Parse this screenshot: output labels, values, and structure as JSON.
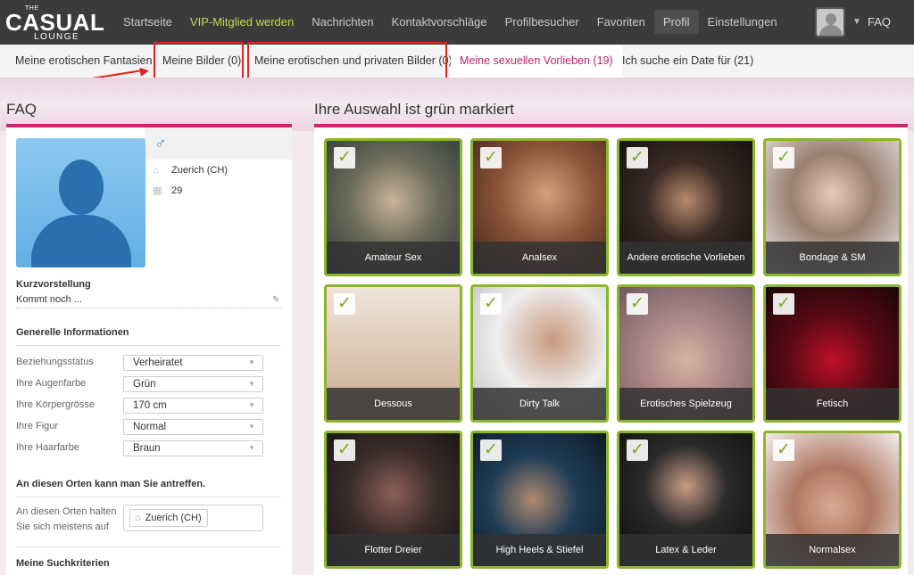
{
  "logo": {
    "the": "THE",
    "casual": "CASUAL",
    "lounge": "LOUNGE"
  },
  "nav": {
    "items": [
      {
        "label": "Startseite"
      },
      {
        "label": "VIP-Mitglied werden"
      },
      {
        "label": "Nachrichten"
      },
      {
        "label": "Kontaktvorschläge"
      },
      {
        "label": "Profilbesucher"
      },
      {
        "label": "Favoriten"
      },
      {
        "label": "Profil"
      },
      {
        "label": "Einstellungen"
      }
    ],
    "faq": "FAQ",
    "vip_color": "#c8d84a"
  },
  "subtabs": [
    {
      "label": "Meine erotischen Fantasien"
    },
    {
      "label": "Meine Bilder (0)"
    },
    {
      "label": "Meine erotischen und privaten Bilder (0)"
    },
    {
      "label": "Meine sexuellen Vorlieben (19)"
    },
    {
      "label": "Ich suche ein Date für (21)"
    }
  ],
  "left": {
    "heading": "FAQ",
    "location": "Zuerich (CH)",
    "age": "29",
    "gender_icon": "male-icon",
    "kurz_title": "Kurzvorstellung",
    "kurz_text": "Kommt noch ...",
    "general_title": "Generelle Informationen",
    "fields": [
      {
        "label": "Beziehungsstatus",
        "value": "Verheiratet"
      },
      {
        "label": "Ihre Augenfarbe",
        "value": "Grün"
      },
      {
        "label": "Ihre Körpergrösse",
        "value": "170 cm"
      },
      {
        "label": "Ihre Figur",
        "value": "Normal"
      },
      {
        "label": "Ihre Haarfarbe",
        "value": "Braun"
      }
    ],
    "places_title": "An diesen Orten kann man Sie antreffen.",
    "places_label_1": "An diesen Orten halten",
    "places_label_2": "Sie sich meistens auf",
    "places_value": "Zuerich (CH)",
    "search_title": "Meine Suchkriterien"
  },
  "right": {
    "heading": "Ihre Auswahl ist grün markiert",
    "accent": "#8bb62a",
    "cards": [
      {
        "label": "Amateur Sex"
      },
      {
        "label": "Analsex"
      },
      {
        "label": "Andere erotische Vorlieben"
      },
      {
        "label": "Bondage & SM"
      },
      {
        "label": "Dessous"
      },
      {
        "label": "Dirty Talk"
      },
      {
        "label": "Erotisches Spielzeug"
      },
      {
        "label": "Fetisch"
      },
      {
        "label": "Flotter Dreier"
      },
      {
        "label": "High Heels & Stiefel"
      },
      {
        "label": "Latex & Leder"
      },
      {
        "label": "Normalsex"
      }
    ]
  }
}
